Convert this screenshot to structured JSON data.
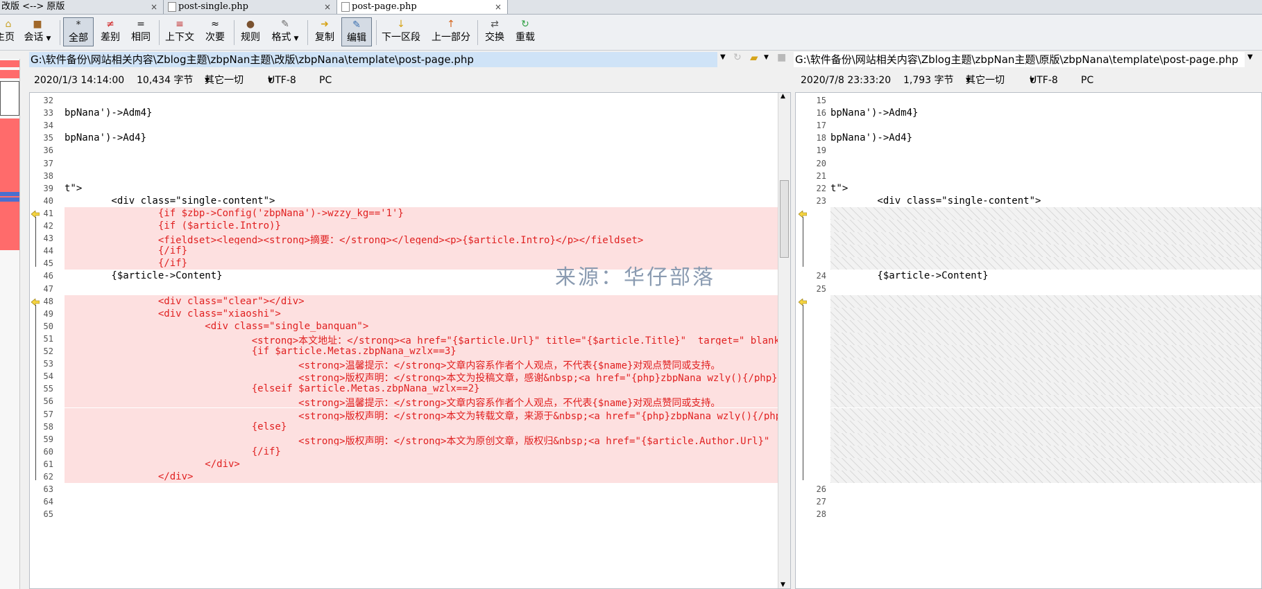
{
  "tabs": [
    {
      "label": "改版 <--> 原版",
      "close": "×"
    },
    {
      "label": "post-single.php",
      "close": "×"
    },
    {
      "label": "post-page.php",
      "close": "×"
    }
  ],
  "toolbar": {
    "home": "主页",
    "session": "会话",
    "all": "全部",
    "diffs": "差别",
    "same": "相同",
    "context": "上下文",
    "minor": "次要",
    "rules": "规则",
    "format": "格式",
    "copy": "复制",
    "edit": "编辑",
    "next": "下一区段",
    "prev": "上一部分",
    "swap": "交换",
    "reload": "重载"
  },
  "left": {
    "path": "G:\\软件备份\\网站相关内容\\Zblog主题\\zbpNan主题\\改版\\zbpNana\\template\\post-page.php",
    "date": "2020/1/3 14:14:00",
    "size": "10,434 字节",
    "other": "其它一切",
    "encoding": "UTF-8",
    "platform": "PC",
    "lines": [
      {
        "n": "32",
        "t": "",
        "d": false
      },
      {
        "n": "33",
        "t": "bpNana')->Adm4}",
        "d": false
      },
      {
        "n": "34",
        "t": "",
        "d": false
      },
      {
        "n": "35",
        "t": "bpNana')->Ad4}",
        "d": false
      },
      {
        "n": "36",
        "t": "",
        "d": false
      },
      {
        "n": "37",
        "t": "",
        "d": false
      },
      {
        "n": "38",
        "t": "",
        "d": false
      },
      {
        "n": "39",
        "t": "t\">",
        "d": false
      },
      {
        "n": "40",
        "t": "        <div class=\"single-content\">",
        "d": false
      },
      {
        "n": "41",
        "t": "                {if $zbp->Config('zbpNana')->wzzy_kg=='1'}",
        "d": true
      },
      {
        "n": "42",
        "t": "                {if ($article.Intro)}",
        "d": true
      },
      {
        "n": "43",
        "t": "                <fieldset><legend><strong>摘要：</strong></legend><p>{$article.Intro}</p></fieldset>",
        "d": true
      },
      {
        "n": "44",
        "t": "                {/if}",
        "d": true
      },
      {
        "n": "45",
        "t": "                {/if}",
        "d": true
      },
      {
        "n": "46",
        "t": "        {$article->Content}",
        "d": false
      },
      {
        "n": "47",
        "t": "",
        "d": false
      },
      {
        "n": "48",
        "t": "                <div class=\"clear\"></div>",
        "d": true
      },
      {
        "n": "49",
        "t": "                <div class=\"xiaoshi\">",
        "d": true
      },
      {
        "n": "50",
        "t": "                        <div class=\"single_banquan\">",
        "d": true
      },
      {
        "n": "51",
        "t": "                                <strong>本文地址：</strong><a href=\"{$article.Url}\" title=\"{$article.Title}\"  target=\"_blank\">",
        "d": true
      },
      {
        "n": "52",
        "t": "                                {if $article.Metas.zbpNana_wzlx==3}",
        "d": true
      },
      {
        "n": "53",
        "t": "                                        <strong>温馨提示：</strong>文章内容系作者个人观点，不代表{$name}对观点赞同或支持。",
        "d": true
      },
      {
        "n": "54",
        "t": "                                        <strong>版权声明：</strong>本文为投稿文章，感谢&nbsp;<a href=\"{php}zbpNana_wzly(){/php}",
        "d": true
      },
      {
        "n": "55",
        "t": "                                {elseif $article.Metas.zbpNana_wzlx==2}",
        "d": true
      },
      {
        "n": "56",
        "t": "                                        <strong>温馨提示：</strong>文章内容系作者个人观点，不代表{$name}对观点赞同或支持。",
        "d": true
      },
      {
        "n": "57",
        "t": "                                        <strong>版权声明：</strong>本文为转载文章，来源于&nbsp;<a href=\"{php}zbpNana_wzly(){/php}",
        "d": true
      },
      {
        "n": "58",
        "t": "                                {else}",
        "d": true
      },
      {
        "n": "59",
        "t": "                                        <strong>版权声明：</strong>本文为原创文章，版权归&nbsp;<a href=\"{$article.Author.Url}\"",
        "d": true
      },
      {
        "n": "60",
        "t": "                                {/if}",
        "d": true
      },
      {
        "n": "61",
        "t": "                        </div>",
        "d": true
      },
      {
        "n": "62",
        "t": "                </div>",
        "d": true
      },
      {
        "n": "63",
        "t": "",
        "d": false
      },
      {
        "n": "64",
        "t": "",
        "d": false
      },
      {
        "n": "65",
        "t": "",
        "d": false
      }
    ]
  },
  "right": {
    "path": "G:\\软件备份\\网站相关内容\\Zblog主题\\zbpNan主题\\原版\\zbpNana\\template\\post-page.php",
    "date": "2020/7/8 23:33:20",
    "size": "1,793 字节",
    "other": "其它一切",
    "encoding": "UTF-8",
    "platform": "PC",
    "lines": [
      {
        "n": "15",
        "t": "",
        "h": false
      },
      {
        "n": "16",
        "t": "bpNana')->Adm4}",
        "h": false
      },
      {
        "n": "17",
        "t": "",
        "h": false
      },
      {
        "n": "18",
        "t": "bpNana')->Ad4}",
        "h": false
      },
      {
        "n": "19",
        "t": "",
        "h": false
      },
      {
        "n": "20",
        "t": "",
        "h": false
      },
      {
        "n": "21",
        "t": "",
        "h": false
      },
      {
        "n": "22",
        "t": "t\">",
        "h": false
      },
      {
        "n": "23",
        "t": "        <div class=\"single-content\">",
        "h": false
      },
      {
        "n": "",
        "t": "",
        "h": true
      },
      {
        "n": "",
        "t": "",
        "h": true
      },
      {
        "n": "",
        "t": "",
        "h": true
      },
      {
        "n": "",
        "t": "",
        "h": true
      },
      {
        "n": "",
        "t": "",
        "h": true
      },
      {
        "n": "24",
        "t": "        {$article->Content}",
        "h": false
      },
      {
        "n": "25",
        "t": "",
        "h": false
      },
      {
        "n": "",
        "t": "",
        "h": true
      },
      {
        "n": "",
        "t": "",
        "h": true
      },
      {
        "n": "",
        "t": "",
        "h": true
      },
      {
        "n": "",
        "t": "",
        "h": true
      },
      {
        "n": "",
        "t": "",
        "h": true
      },
      {
        "n": "",
        "t": "",
        "h": true
      },
      {
        "n": "",
        "t": "",
        "h": true
      },
      {
        "n": "",
        "t": "",
        "h": true
      },
      {
        "n": "",
        "t": "",
        "h": true
      },
      {
        "n": "",
        "t": "",
        "h": true
      },
      {
        "n": "",
        "t": "",
        "h": true
      },
      {
        "n": "",
        "t": "",
        "h": true
      },
      {
        "n": "",
        "t": "",
        "h": true
      },
      {
        "n": "",
        "t": "",
        "h": true
      },
      {
        "n": "",
        "t": "",
        "h": true
      },
      {
        "n": "26",
        "t": "",
        "h": false
      },
      {
        "n": "27",
        "t": "",
        "h": false
      },
      {
        "n": "28",
        "t": "",
        "h": false
      }
    ]
  },
  "watermark": "来源：华仔部落",
  "colors": {
    "diff_bg": "#fde0e0",
    "diff_text": "#e02020",
    "selection": "#cfe3f7"
  }
}
